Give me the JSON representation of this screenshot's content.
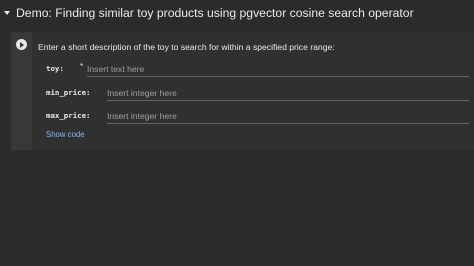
{
  "section": {
    "title": "Demo: Finding similar toy products using pgvector cosine search operator"
  },
  "form": {
    "description": "Enter a short description of the toy to search for within a specified price range:",
    "fields": [
      {
        "label": "toy:",
        "required_mark": "*",
        "placeholder": "Insert text here",
        "value": ""
      },
      {
        "label": "min_price:",
        "placeholder": "Insert integer here",
        "value": ""
      },
      {
        "label": "max_price:",
        "placeholder": "Insert integer here",
        "value": ""
      }
    ],
    "show_code_label": "Show code"
  },
  "colors": {
    "page_bg": "#2b2b2b",
    "cell_bg": "#383838",
    "form_bg": "#303030",
    "link": "#8ab4f8"
  },
  "icons": {
    "collapse": "caret-down-icon",
    "run": "play-circle-icon"
  }
}
